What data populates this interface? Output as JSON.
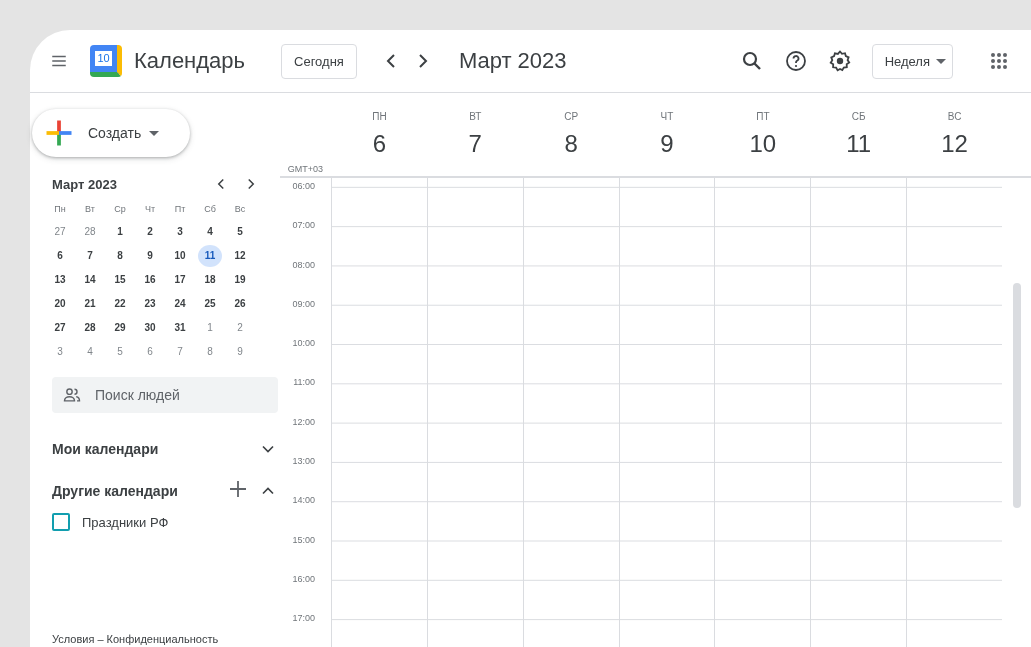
{
  "topbar": {
    "app_name": "Календарь",
    "logo_day": "10",
    "today_button": "Сегодня",
    "period": "Март 2023",
    "view_button": "Неделя"
  },
  "sidebar": {
    "create_button": "Создать",
    "mini_calendar": {
      "title": "Март 2023",
      "weekdays": [
        "Пн",
        "Вт",
        "Ср",
        "Чт",
        "Пт",
        "Сб",
        "Вс"
      ],
      "weeks": [
        [
          {
            "day": "27",
            "muted": true,
            "selected": false
          },
          {
            "day": "28",
            "muted": true,
            "selected": false
          },
          {
            "day": "1",
            "muted": false,
            "selected": false
          },
          {
            "day": "2",
            "muted": false,
            "selected": false
          },
          {
            "day": "3",
            "muted": false,
            "selected": false
          },
          {
            "day": "4",
            "muted": false,
            "selected": false
          },
          {
            "day": "5",
            "muted": false,
            "selected": false
          }
        ],
        [
          {
            "day": "6",
            "muted": false,
            "selected": false
          },
          {
            "day": "7",
            "muted": false,
            "selected": false
          },
          {
            "day": "8",
            "muted": false,
            "selected": false
          },
          {
            "day": "9",
            "muted": false,
            "selected": false
          },
          {
            "day": "10",
            "muted": false,
            "selected": false
          },
          {
            "day": "11",
            "muted": false,
            "selected": true
          },
          {
            "day": "12",
            "muted": false,
            "selected": false
          }
        ],
        [
          {
            "day": "13",
            "muted": false,
            "selected": false
          },
          {
            "day": "14",
            "muted": false,
            "selected": false
          },
          {
            "day": "15",
            "muted": false,
            "selected": false
          },
          {
            "day": "16",
            "muted": false,
            "selected": false
          },
          {
            "day": "17",
            "muted": false,
            "selected": false
          },
          {
            "day": "18",
            "muted": false,
            "selected": false
          },
          {
            "day": "19",
            "muted": false,
            "selected": false
          }
        ],
        [
          {
            "day": "20",
            "muted": false,
            "selected": false
          },
          {
            "day": "21",
            "muted": false,
            "selected": false
          },
          {
            "day": "22",
            "muted": false,
            "selected": false
          },
          {
            "day": "23",
            "muted": false,
            "selected": false
          },
          {
            "day": "24",
            "muted": false,
            "selected": false
          },
          {
            "day": "25",
            "muted": false,
            "selected": false
          },
          {
            "day": "26",
            "muted": false,
            "selected": false
          }
        ],
        [
          {
            "day": "27",
            "muted": false,
            "selected": false
          },
          {
            "day": "28",
            "muted": false,
            "selected": false
          },
          {
            "day": "29",
            "muted": false,
            "selected": false
          },
          {
            "day": "30",
            "muted": false,
            "selected": false
          },
          {
            "day": "31",
            "muted": false,
            "selected": false
          },
          {
            "day": "1",
            "muted": true,
            "selected": false
          },
          {
            "day": "2",
            "muted": true,
            "selected": false
          }
        ],
        [
          {
            "day": "3",
            "muted": true,
            "selected": false
          },
          {
            "day": "4",
            "muted": true,
            "selected": false
          },
          {
            "day": "5",
            "muted": true,
            "selected": false
          },
          {
            "day": "6",
            "muted": true,
            "selected": false
          },
          {
            "day": "7",
            "muted": true,
            "selected": false
          },
          {
            "day": "8",
            "muted": true,
            "selected": false
          },
          {
            "day": "9",
            "muted": true,
            "selected": false
          }
        ]
      ]
    },
    "people_search": {
      "placeholder": "Поиск людей"
    },
    "sections": [
      {
        "title": "Мои календари",
        "expanded": false,
        "can_add": false
      },
      {
        "title": "Другие календари",
        "expanded": true,
        "can_add": true,
        "calendars": [
          {
            "name": "Праздники РФ",
            "checked": false,
            "color": "#129eaf"
          }
        ]
      }
    ],
    "footer": "Условия – Конфиденциальность"
  },
  "week": {
    "timezone": "GMT+03",
    "days": [
      {
        "weekday": "ПН",
        "date": "6"
      },
      {
        "weekday": "ВТ",
        "date": "7"
      },
      {
        "weekday": "СР",
        "date": "8"
      },
      {
        "weekday": "ЧТ",
        "date": "9"
      },
      {
        "weekday": "ПТ",
        "date": "10"
      },
      {
        "weekday": "СБ",
        "date": "11"
      },
      {
        "weekday": "ВС",
        "date": "12"
      }
    ],
    "hours": [
      "06:00",
      "07:00",
      "08:00",
      "09:00",
      "10:00",
      "11:00",
      "12:00",
      "13:00",
      "14:00",
      "15:00",
      "16:00",
      "17:00"
    ]
  }
}
